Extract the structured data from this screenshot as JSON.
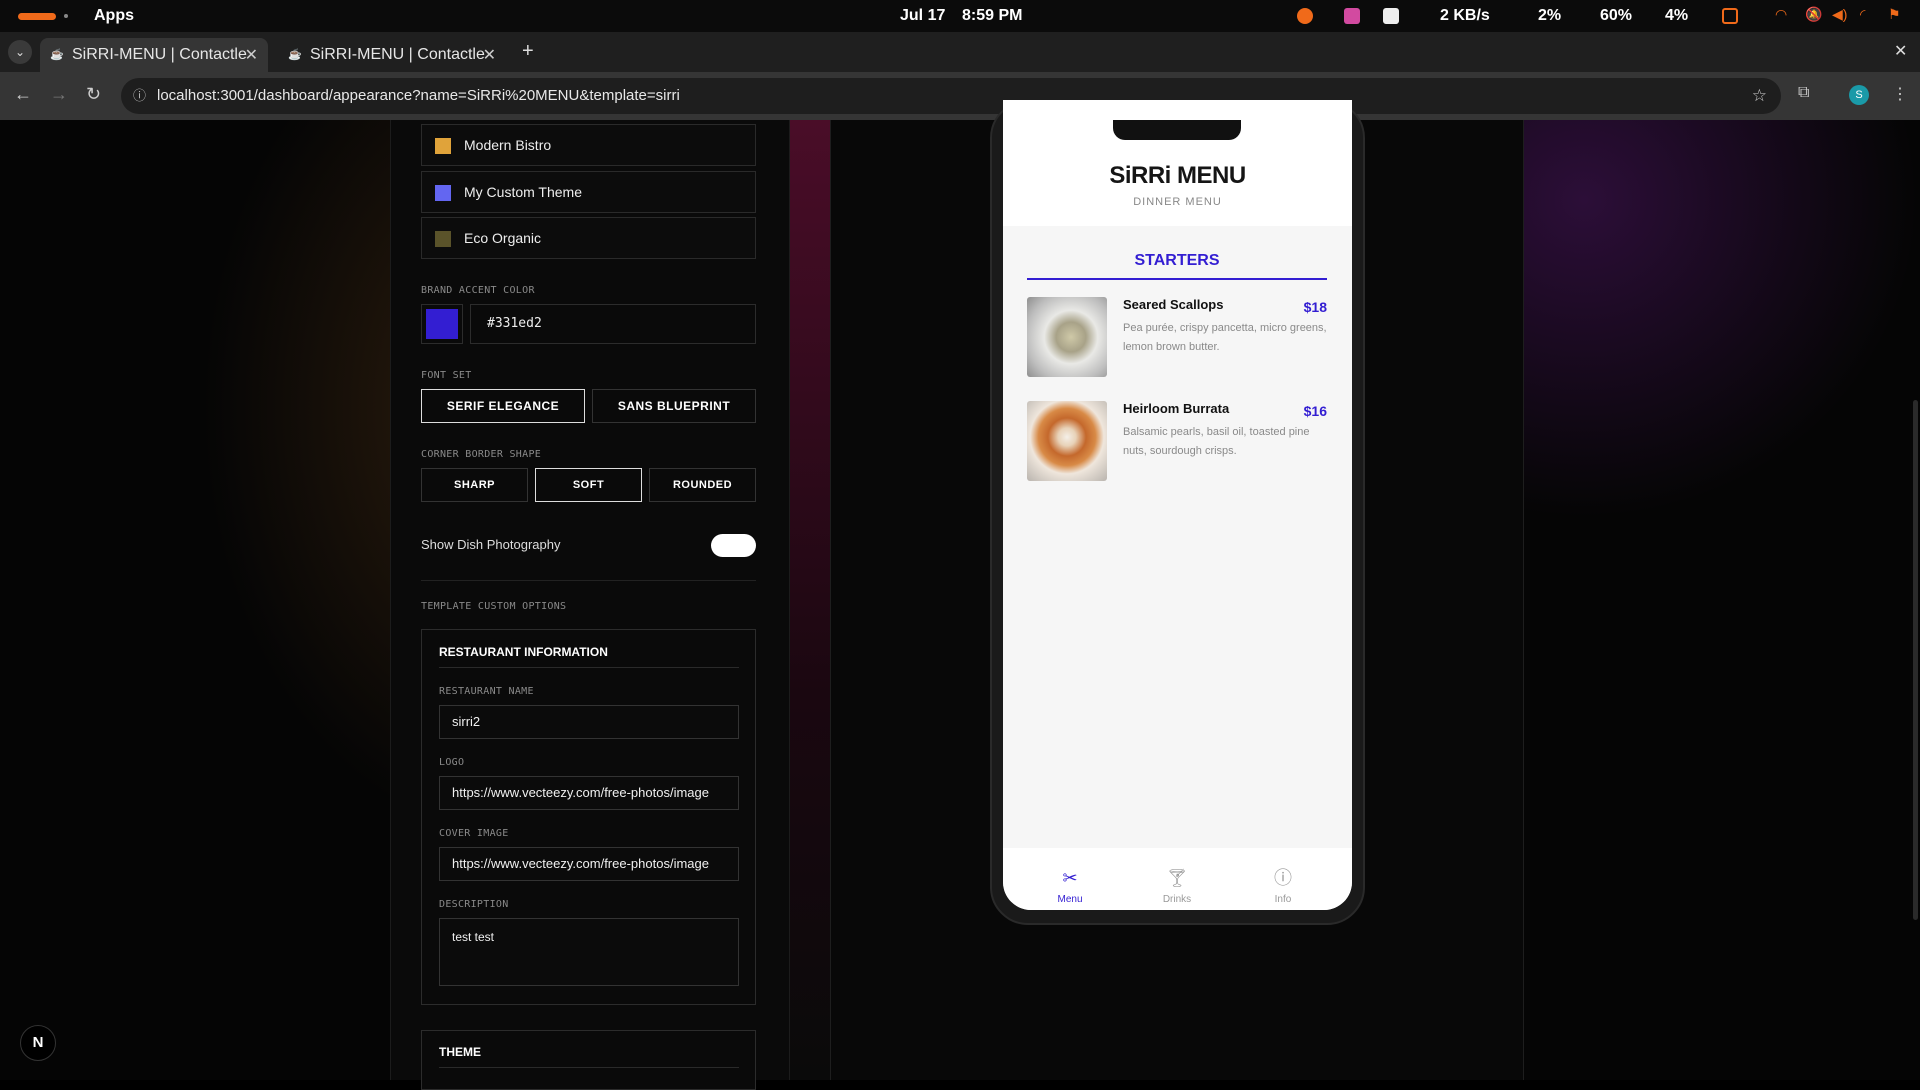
{
  "os": {
    "apps_label": "Apps",
    "date": "Jul 17",
    "time": "8:59 PM",
    "net": "2 KB/s",
    "cpu": "2%",
    "battery1": "60%",
    "battery2": "4%"
  },
  "browser": {
    "tabs": [
      {
        "title": "SiRRI-MENU | Contactle"
      },
      {
        "title": "SiRRI-MENU | Contactle"
      }
    ],
    "url": "localhost:3001/dashboard/appearance?name=SiRRi%20MENU&template=sirri",
    "profile_initial": "S"
  },
  "themes": [
    {
      "name": "Modern Bistro",
      "color": "#e0a33a"
    },
    {
      "name": "My Custom Theme",
      "color": "#6366f1"
    },
    {
      "name": "Eco Organic",
      "color": "#5a532a"
    }
  ],
  "accent": {
    "label": "BRAND ACCENT COLOR",
    "value": "#331ed2"
  },
  "fontset": {
    "label": "FONT SET",
    "options": [
      "SERIF ELEGANCE",
      "SANS BLUEPRINT"
    ],
    "selected": "SERIF ELEGANCE"
  },
  "corner": {
    "label": "CORNER BORDER SHAPE",
    "options": [
      "SHARP",
      "SOFT",
      "ROUNDED"
    ],
    "selected": "SOFT"
  },
  "photo_toggle": {
    "label": "Show Dish Photography",
    "on": true
  },
  "template_options": {
    "label": "TEMPLATE CUSTOM OPTIONS",
    "restaurant_info": {
      "heading": "RESTAURANT INFORMATION",
      "name_label": "RESTAURANT NAME",
      "name_value": "sirri2",
      "logo_label": "LOGO",
      "logo_value": "https://www.vecteezy.com/free-photos/image",
      "cover_label": "COVER IMAGE",
      "cover_value": "https://www.vecteezy.com/free-photos/image",
      "desc_label": "DESCRIPTION",
      "desc_value": "test test"
    },
    "theme_heading": "THEME"
  },
  "preview": {
    "title": "SiRRi MENU",
    "subtitle": "DINNER MENU",
    "section": "STARTERS",
    "dishes": [
      {
        "name": "Seared Scallops",
        "price": "$18",
        "desc": "Pea purée, crispy pancetta, micro greens, lemon brown butter."
      },
      {
        "name": "Heirloom Burrata",
        "price": "$16",
        "desc": "Balsamic pearls, basil oil, toasted pine nuts, sourdough crisps."
      }
    ],
    "nav": [
      "Menu",
      "Drinks",
      "Info"
    ]
  },
  "next_badge": "N"
}
